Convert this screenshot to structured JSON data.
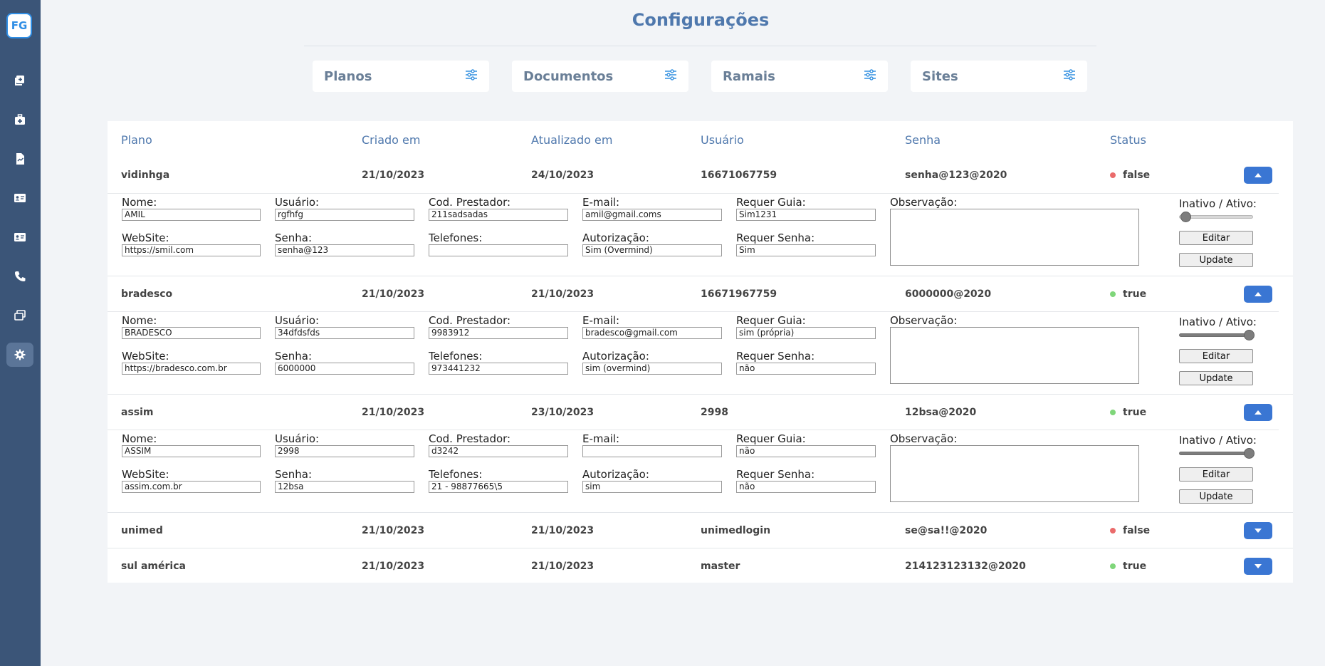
{
  "app": {
    "logo": "FG",
    "title": "Configurações"
  },
  "sidebar": {
    "items": [
      {
        "icon": "add-document-icon"
      },
      {
        "icon": "medical-kit-icon"
      },
      {
        "icon": "file-report-icon"
      },
      {
        "icon": "id-card-icon"
      },
      {
        "icon": "contact-card-icon"
      },
      {
        "icon": "phone-icon"
      },
      {
        "icon": "windows-icon"
      },
      {
        "icon": "gear-icon",
        "active": true
      }
    ]
  },
  "cards": [
    {
      "label": "Planos"
    },
    {
      "label": "Documentos"
    },
    {
      "label": "Ramais"
    },
    {
      "label": "Sites"
    }
  ],
  "table": {
    "headers": [
      "Plano",
      "Criado em",
      "Atualizado em",
      "Usuário",
      "Senha",
      "Status"
    ],
    "rows": [
      {
        "plano": "vidinhga",
        "criado": "21/10/2023",
        "atualizado": "24/10/2023",
        "usuario": "16671067759",
        "senha": "senha@123@2020",
        "status": "false",
        "expanded": true,
        "detail": {
          "nome": "AMIL",
          "usuario": "rgfhfg",
          "cod_prestador": "211sadsadas",
          "email": "amil@gmail.coms",
          "requer_guia": "Sim1231",
          "website": "https://smil.com",
          "senha": "senha@123",
          "telefones": "",
          "autorizacao": "Sim (Overmind)",
          "requer_senha": "Sim",
          "ativo": false
        }
      },
      {
        "plano": "bradesco",
        "criado": "21/10/2023",
        "atualizado": "21/10/2023",
        "usuario": "16671967759",
        "senha": "6000000@2020",
        "status": "true",
        "expanded": true,
        "detail": {
          "nome": "BRADESCO",
          "usuario": "34dfdsfds",
          "cod_prestador": "9983912",
          "email": "bradesco@gmail.com",
          "requer_guia": "sim (própria)",
          "website": "https://bradesco.com.br",
          "senha": "6000000",
          "telefones": "973441232",
          "autorizacao": "sim (overmind)",
          "requer_senha": "não",
          "ativo": true
        }
      },
      {
        "plano": "assim",
        "criado": "21/10/2023",
        "atualizado": "23/10/2023",
        "usuario": "2998",
        "senha": "12bsa@2020",
        "status": "true",
        "expanded": true,
        "detail": {
          "nome": "ASSIM",
          "usuario": "2998",
          "cod_prestador": "d3242",
          "email": "",
          "requer_guia": "não",
          "website": "assim.com.br",
          "senha": "12bsa",
          "telefones": "21 - 98877665\\5",
          "autorizacao": "sim",
          "requer_senha": "não",
          "ativo": true
        }
      },
      {
        "plano": "unimed",
        "criado": "21/10/2023",
        "atualizado": "21/10/2023",
        "usuario": "unimedlogin",
        "senha": "se@sa!!@2020",
        "status": "false",
        "expanded": false
      },
      {
        "plano": "sul américa",
        "criado": "21/10/2023",
        "atualizado": "21/10/2023",
        "usuario": "master",
        "senha": "214123123132@2020",
        "status": "true",
        "expanded": false
      }
    ]
  },
  "labels": {
    "nome": "Nome:",
    "usuario": "Usuário:",
    "cod_prestador": "Cod. Prestador:",
    "email": "E-mail:",
    "requer_guia": "Requer Guia:",
    "observacao": "Observação:",
    "inativo_ativo": "Inativo / Ativo:",
    "website": "WebSite:",
    "senha": "Senha:",
    "telefones": "Telefones:",
    "autorizacao": "Autorização:",
    "requer_senha": "Requer Senha:",
    "editar": "Editar",
    "update": "Update"
  },
  "colors": {
    "sidebar": "#3b5578",
    "accent": "#4f78ad",
    "button": "#3a76d3",
    "status_true": "#7fd67a",
    "status_false": "#ea6b6b"
  }
}
